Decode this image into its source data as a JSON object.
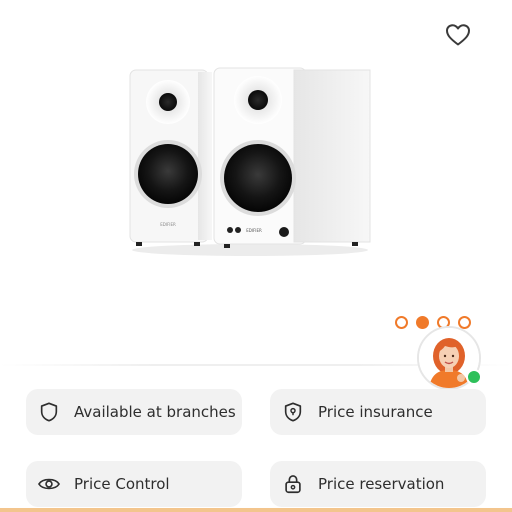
{
  "product": {
    "image_icon": "studio-monitor-speakers-photo",
    "brand_print": "EDIFIER",
    "color": "#ffffff"
  },
  "favorite": {
    "icon": "heart-outline-icon"
  },
  "carousel": {
    "count": 4,
    "active_index": 1,
    "accent": "#f07a2a"
  },
  "assistant": {
    "icon": "support-agent-avatar",
    "status_color": "#2ec05a"
  },
  "features": [
    {
      "label": "Available at branches",
      "icon": "shield-icon"
    },
    {
      "label": "Price insurance",
      "icon": "shield-lock-icon"
    },
    {
      "label": "Price Control",
      "icon": "eye-icon"
    },
    {
      "label": "Price reservation",
      "icon": "lock-icon"
    }
  ],
  "colors": {
    "chip_bg": "#f2f2f2",
    "accent": "#f07a2a",
    "bottom_bar": "#f3c58d"
  }
}
